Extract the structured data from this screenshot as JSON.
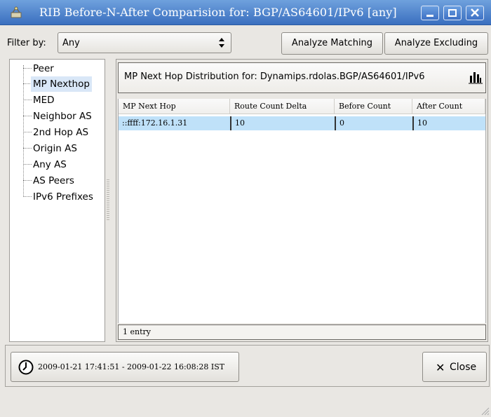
{
  "window": {
    "title": "RIB Before-N-After Comparision for: BGP/AS64601/IPv6 [any]",
    "icon": "network-tool-icon",
    "controls": [
      "minimize-icon",
      "maximize-icon",
      "close-icon"
    ]
  },
  "filter": {
    "label": "Filter by:",
    "selected": "Any",
    "analyze_matching": "Analyze Matching",
    "analyze_excluding": "Analyze Excluding"
  },
  "tree": {
    "items": [
      {
        "label": "Peer",
        "selected": false
      },
      {
        "label": "MP Nexthop",
        "selected": true
      },
      {
        "label": "MED",
        "selected": false
      },
      {
        "label": "Neighbor AS",
        "selected": false
      },
      {
        "label": "2nd Hop AS",
        "selected": false
      },
      {
        "label": "Origin AS",
        "selected": false
      },
      {
        "label": "Any AS",
        "selected": false
      },
      {
        "label": "AS Peers",
        "selected": false
      },
      {
        "label": "IPv6 Prefixes",
        "selected": false
      }
    ]
  },
  "distribution": {
    "title": "MP Next Hop Distribution for: Dynamips.rdolas.BGP/AS64601/IPv6",
    "chart_icon": "bar-chart-icon"
  },
  "table": {
    "columns": [
      "MP Next Hop",
      "Route Count Delta",
      "Before Count",
      "After Count"
    ],
    "rows": [
      [
        "::ffff:172.16.1.31",
        "10",
        "0",
        "10"
      ]
    ],
    "status": "1 entry"
  },
  "footer": {
    "time_range": "2009-01-21 17:41:51 - 2009-01-22 16:08:28 IST",
    "close_label": "Close"
  },
  "colors": {
    "titlebar": "#3a6fbf",
    "selection": "#bfe1f9",
    "tree_selection": "#d9e7f7"
  }
}
